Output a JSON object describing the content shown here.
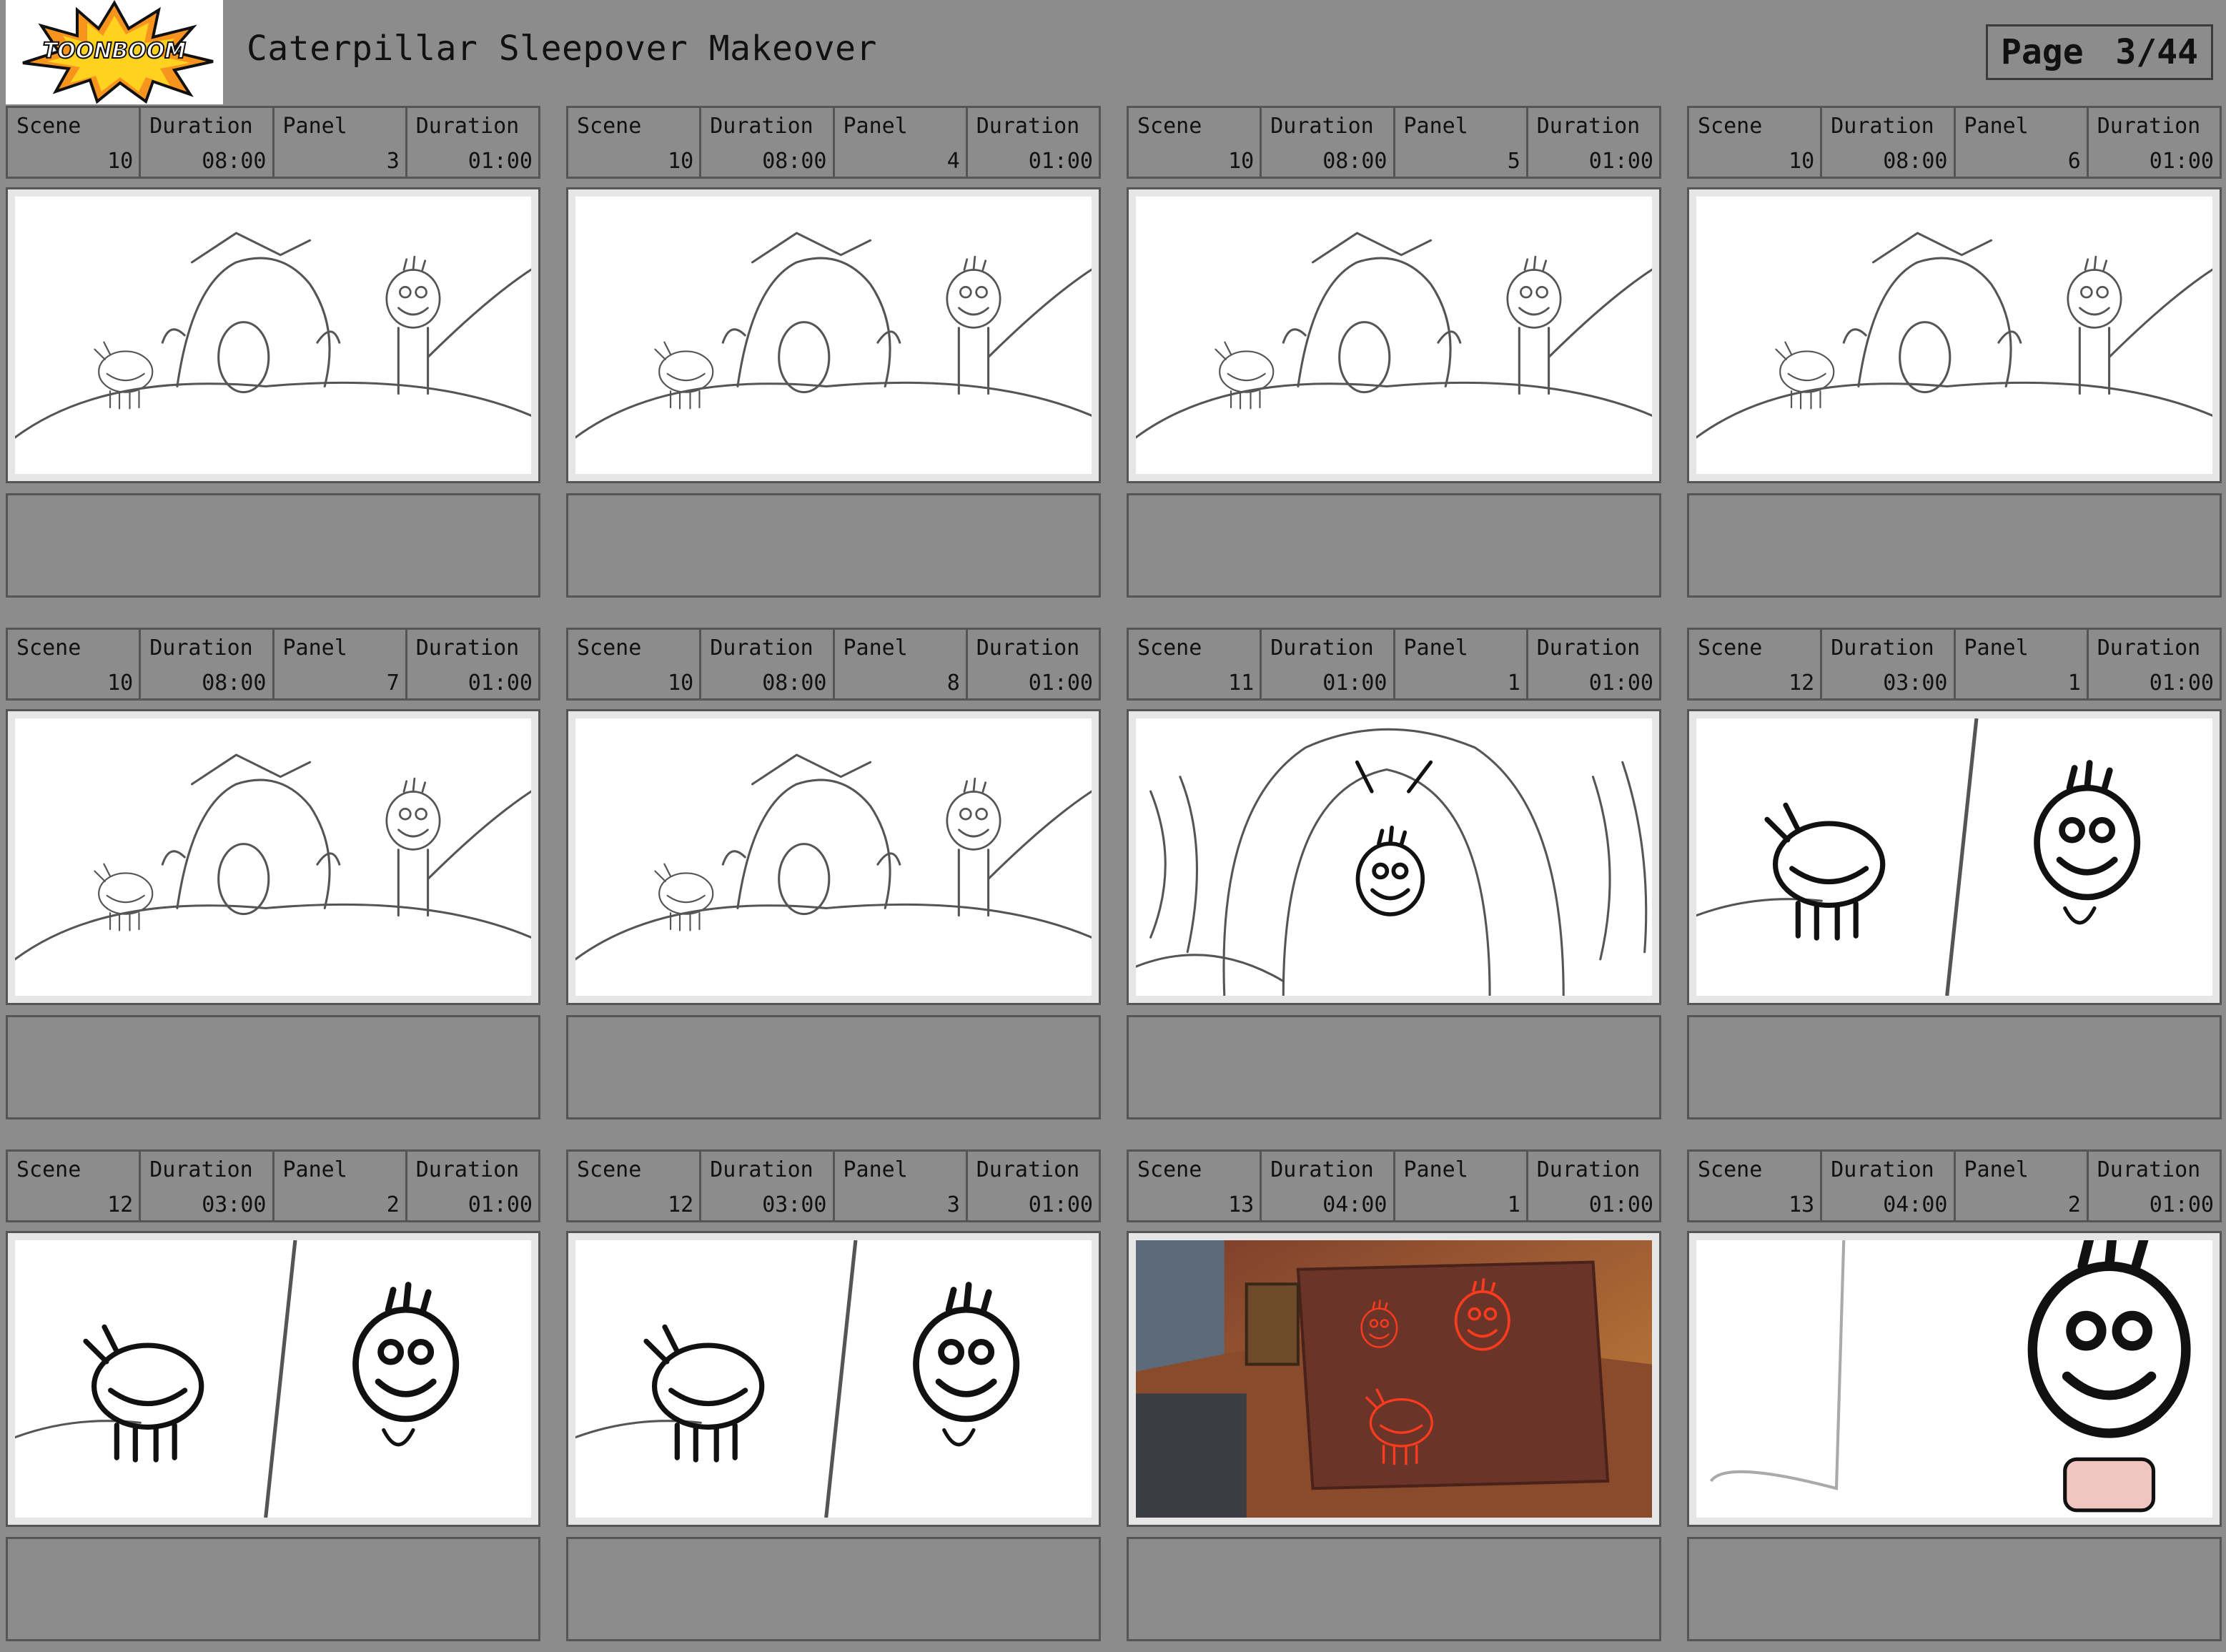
{
  "header": {
    "logo_text": "TOONBOOM",
    "title": "Caterpillar Sleepover Makeover",
    "page_label": "Page",
    "page_value": "3/44"
  },
  "labels": {
    "scene": "Scene",
    "duration": "Duration",
    "panel": "Panel"
  },
  "panels": [
    {
      "scene": "10",
      "scene_duration": "08:00",
      "panel": "3",
      "panel_duration": "01:00",
      "art": "wide-tent"
    },
    {
      "scene": "10",
      "scene_duration": "08:00",
      "panel": "4",
      "panel_duration": "01:00",
      "art": "wide-tent"
    },
    {
      "scene": "10",
      "scene_duration": "08:00",
      "panel": "5",
      "panel_duration": "01:00",
      "art": "wide-tent"
    },
    {
      "scene": "10",
      "scene_duration": "08:00",
      "panel": "6",
      "panel_duration": "01:00",
      "art": "wide-tent"
    },
    {
      "scene": "10",
      "scene_duration": "08:00",
      "panel": "7",
      "panel_duration": "01:00",
      "art": "wide-tent"
    },
    {
      "scene": "10",
      "scene_duration": "08:00",
      "panel": "8",
      "panel_duration": "01:00",
      "art": "wide-tent"
    },
    {
      "scene": "11",
      "scene_duration": "01:00",
      "panel": "1",
      "panel_duration": "01:00",
      "art": "tent-closeup"
    },
    {
      "scene": "12",
      "scene_duration": "03:00",
      "panel": "1",
      "panel_duration": "01:00",
      "art": "split-two"
    },
    {
      "scene": "12",
      "scene_duration": "03:00",
      "panel": "2",
      "panel_duration": "01:00",
      "art": "split-two"
    },
    {
      "scene": "12",
      "scene_duration": "03:00",
      "panel": "3",
      "panel_duration": "01:00",
      "art": "split-two"
    },
    {
      "scene": "13",
      "scene_duration": "04:00",
      "panel": "1",
      "panel_duration": "01:00",
      "art": "couch-color"
    },
    {
      "scene": "13",
      "scene_duration": "04:00",
      "panel": "2",
      "panel_duration": "01:00",
      "art": "closeup-controller"
    }
  ]
}
